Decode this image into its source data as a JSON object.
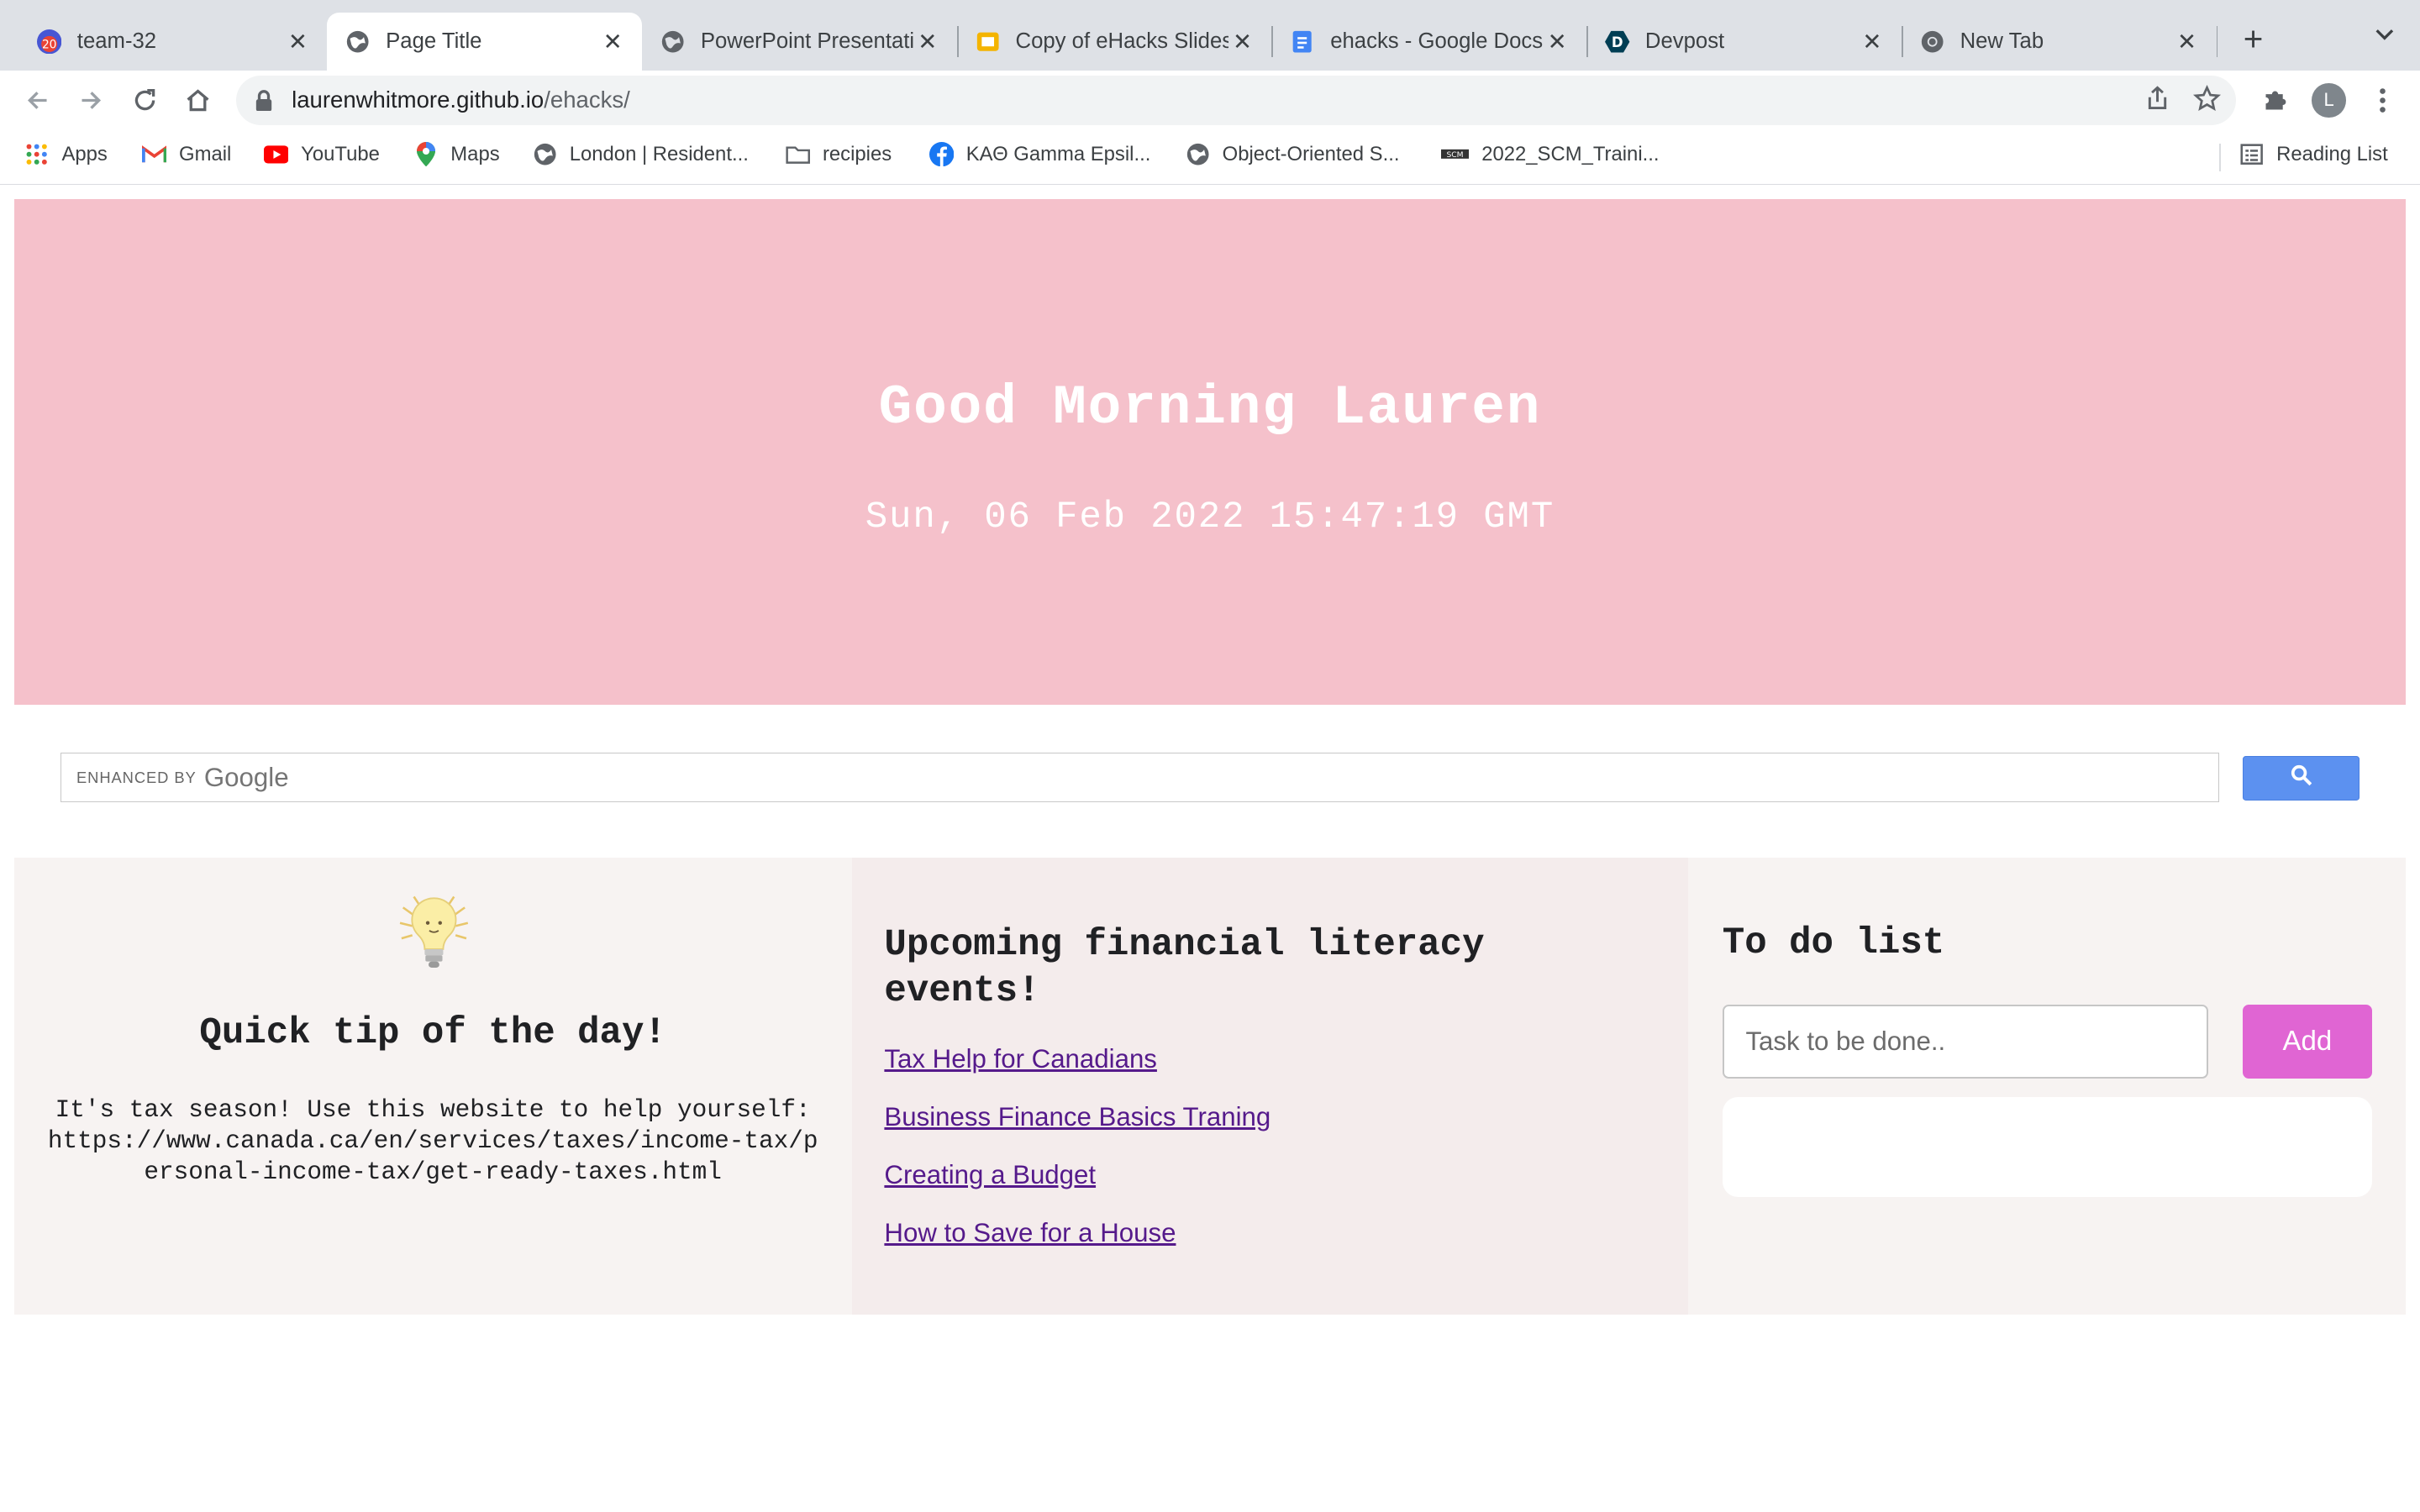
{
  "tabs": [
    {
      "title": "team-32",
      "active": false
    },
    {
      "title": "Page Title",
      "active": true
    },
    {
      "title": "PowerPoint Presentation",
      "active": false
    },
    {
      "title": "Copy of eHacks Slides",
      "active": false
    },
    {
      "title": "ehacks - Google Docs",
      "active": false
    },
    {
      "title": "Devpost",
      "active": false
    },
    {
      "title": "New Tab",
      "active": false
    }
  ],
  "tab_badge": "20",
  "address": {
    "host": "laurenwhitmore.github.io",
    "path": "/ehacks/"
  },
  "profile_initial": "L",
  "bookmarks": [
    {
      "label": "Apps",
      "icon": "apps-grid-icon"
    },
    {
      "label": "Gmail",
      "icon": "gmail-icon"
    },
    {
      "label": "YouTube",
      "icon": "youtube-icon"
    },
    {
      "label": "Maps",
      "icon": "maps-pin-icon"
    },
    {
      "label": "London | Resident...",
      "icon": "globe-icon"
    },
    {
      "label": "recipies",
      "icon": "folder-icon"
    },
    {
      "label": "ΚΑΘ Gamma Epsil...",
      "icon": "facebook-icon"
    },
    {
      "label": "Object-Oriented S...",
      "icon": "globe-icon"
    },
    {
      "label": "2022_SCM_Traini...",
      "icon": "scm-icon"
    }
  ],
  "reading_list": "Reading List",
  "hero": {
    "greeting": "Good Morning Lauren",
    "datetime": "Sun, 06 Feb 2022 15:47:19 GMT"
  },
  "search": {
    "enhanced_by": "ENHANCED BY",
    "brand": "Google"
  },
  "tip": {
    "title": "Quick tip of the day!",
    "text": "It's tax season! Use this website to help yourself: https://www.canada.ca/en/services/taxes/income-tax/personal-income-tax/get-ready-taxes.html"
  },
  "events": {
    "title": "Upcoming financial literacy events!",
    "items": [
      "Tax Help for Canadians",
      "Business Finance Basics Traning",
      "Creating a Budget",
      "How to Save for a House"
    ]
  },
  "todo": {
    "title": "To do list",
    "placeholder": "Task to be done..",
    "add_label": "Add"
  },
  "colors": {
    "hero_bg": "#f5c1cb",
    "add_button": "#e065d3",
    "search_button": "#5c91f0",
    "link": "#551a8b"
  }
}
